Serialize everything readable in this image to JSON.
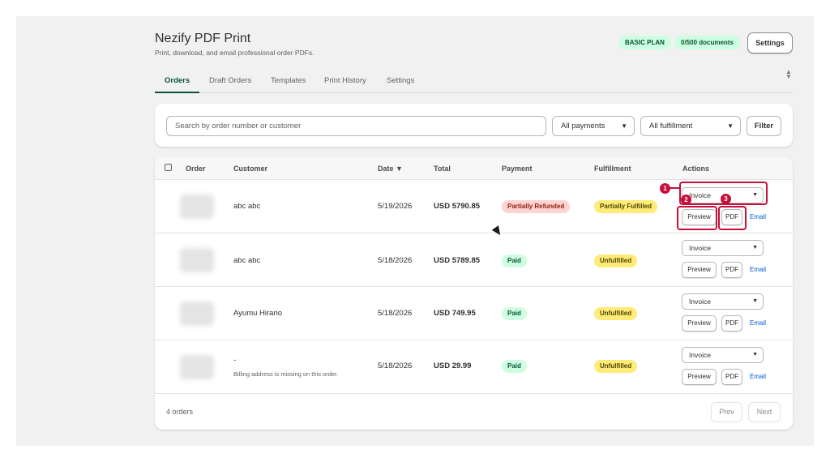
{
  "app": {
    "title": "Nezify PDF Print",
    "subtitle": "Print, download, and email professional order PDFs.",
    "plan_badge": "BASIC PLAN",
    "docs_badge": "0/500 documents",
    "settings_label": "Settings"
  },
  "tabs": [
    {
      "label": "Orders",
      "active": true
    },
    {
      "label": "Draft Orders"
    },
    {
      "label": "Templates"
    },
    {
      "label": "Print History"
    },
    {
      "label": "Settings"
    }
  ],
  "filters": {
    "search_placeholder": "Search by order number or customer",
    "payment_select": "All payments",
    "fulfillment_select": "All fulfillment",
    "filter_label": "Filter"
  },
  "table": {
    "columns": [
      "Order",
      "Customer",
      "Date ▼",
      "Total",
      "Payment",
      "Fulfillment",
      "Actions"
    ],
    "rows": [
      {
        "customer": "abc abc",
        "customer_note": "",
        "date": "5/19/2026",
        "total": "USD 5790.85",
        "payment": "Partially Refunded",
        "fulfillment": "Partially Fulfilled",
        "doc_type": "Invoice",
        "preview": "Preview",
        "pdf": "PDF",
        "email": "Email"
      },
      {
        "customer": "abc abc",
        "customer_note": "",
        "date": "5/18/2026",
        "total": "USD 5789.85",
        "payment": "Paid",
        "fulfillment": "Unfulfilled",
        "doc_type": "Invoice",
        "preview": "Preview",
        "pdf": "PDF",
        "email": "Email"
      },
      {
        "customer": "Ayumu Hirano",
        "customer_note": "",
        "date": "5/18/2026",
        "total": "USD 749.95",
        "payment": "Paid",
        "fulfillment": "Unfulfilled",
        "doc_type": "Invoice",
        "preview": "Preview",
        "pdf": "PDF",
        "email": "Email"
      },
      {
        "customer": "-",
        "customer_note": "Billing address is missing on this order.",
        "date": "5/18/2026",
        "total": "USD 29.99",
        "payment": "Paid",
        "fulfillment": "Unfulfilled",
        "doc_type": "Invoice",
        "preview": "Preview",
        "pdf": "PDF",
        "email": "Email"
      }
    ]
  },
  "footer": {
    "count": "4 orders",
    "prev": "Prev",
    "next": "Next"
  },
  "annotations": [
    "1",
    "2",
    "3"
  ],
  "colors": {
    "accent_green": "#0c5132",
    "annotation_red": "#c4103a",
    "link_blue": "#005bd3"
  }
}
